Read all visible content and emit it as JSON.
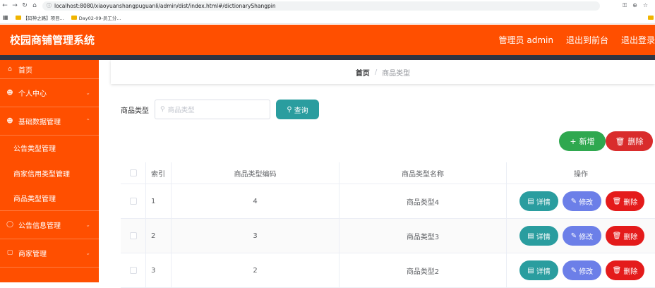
{
  "browser": {
    "url": "localhost:8080/xiaoyuanshangpuguanli/admin/dist/index.html#/dictionaryShangpin",
    "bookmarks": [
      "【码神之路】项目...",
      "Day02-09-员工分..."
    ]
  },
  "header": {
    "title": "校园商铺管理系统",
    "user": "管理员 admin",
    "front": "退出到前台",
    "logout": "退出登录"
  },
  "sidebar": {
    "items": [
      {
        "label": "首页"
      },
      {
        "label": "个人中心"
      },
      {
        "label": "基础数据管理"
      },
      {
        "label": "公告类型管理"
      },
      {
        "label": "商家信用类型管理"
      },
      {
        "label": "商品类型管理"
      },
      {
        "label": "公告信息管理"
      },
      {
        "label": "商家管理"
      }
    ]
  },
  "breadcrumb": {
    "home": "首页",
    "separator": "/",
    "current": "商品类型"
  },
  "search": {
    "label": "商品类型",
    "placeholder": "商品类型",
    "button": "查询"
  },
  "actions": {
    "add": "新增",
    "delete": "删除"
  },
  "table": {
    "headers": [
      "索引",
      "商品类型编码",
      "商品类型名称",
      "操作"
    ],
    "rows": [
      {
        "index": "1",
        "code": "4",
        "name": "商品类型4"
      },
      {
        "index": "2",
        "code": "3",
        "name": "商品类型3"
      },
      {
        "index": "3",
        "code": "2",
        "name": "商品类型2"
      }
    ],
    "ops": {
      "detail": "详情",
      "edit": "修改",
      "delete": "删除"
    }
  }
}
